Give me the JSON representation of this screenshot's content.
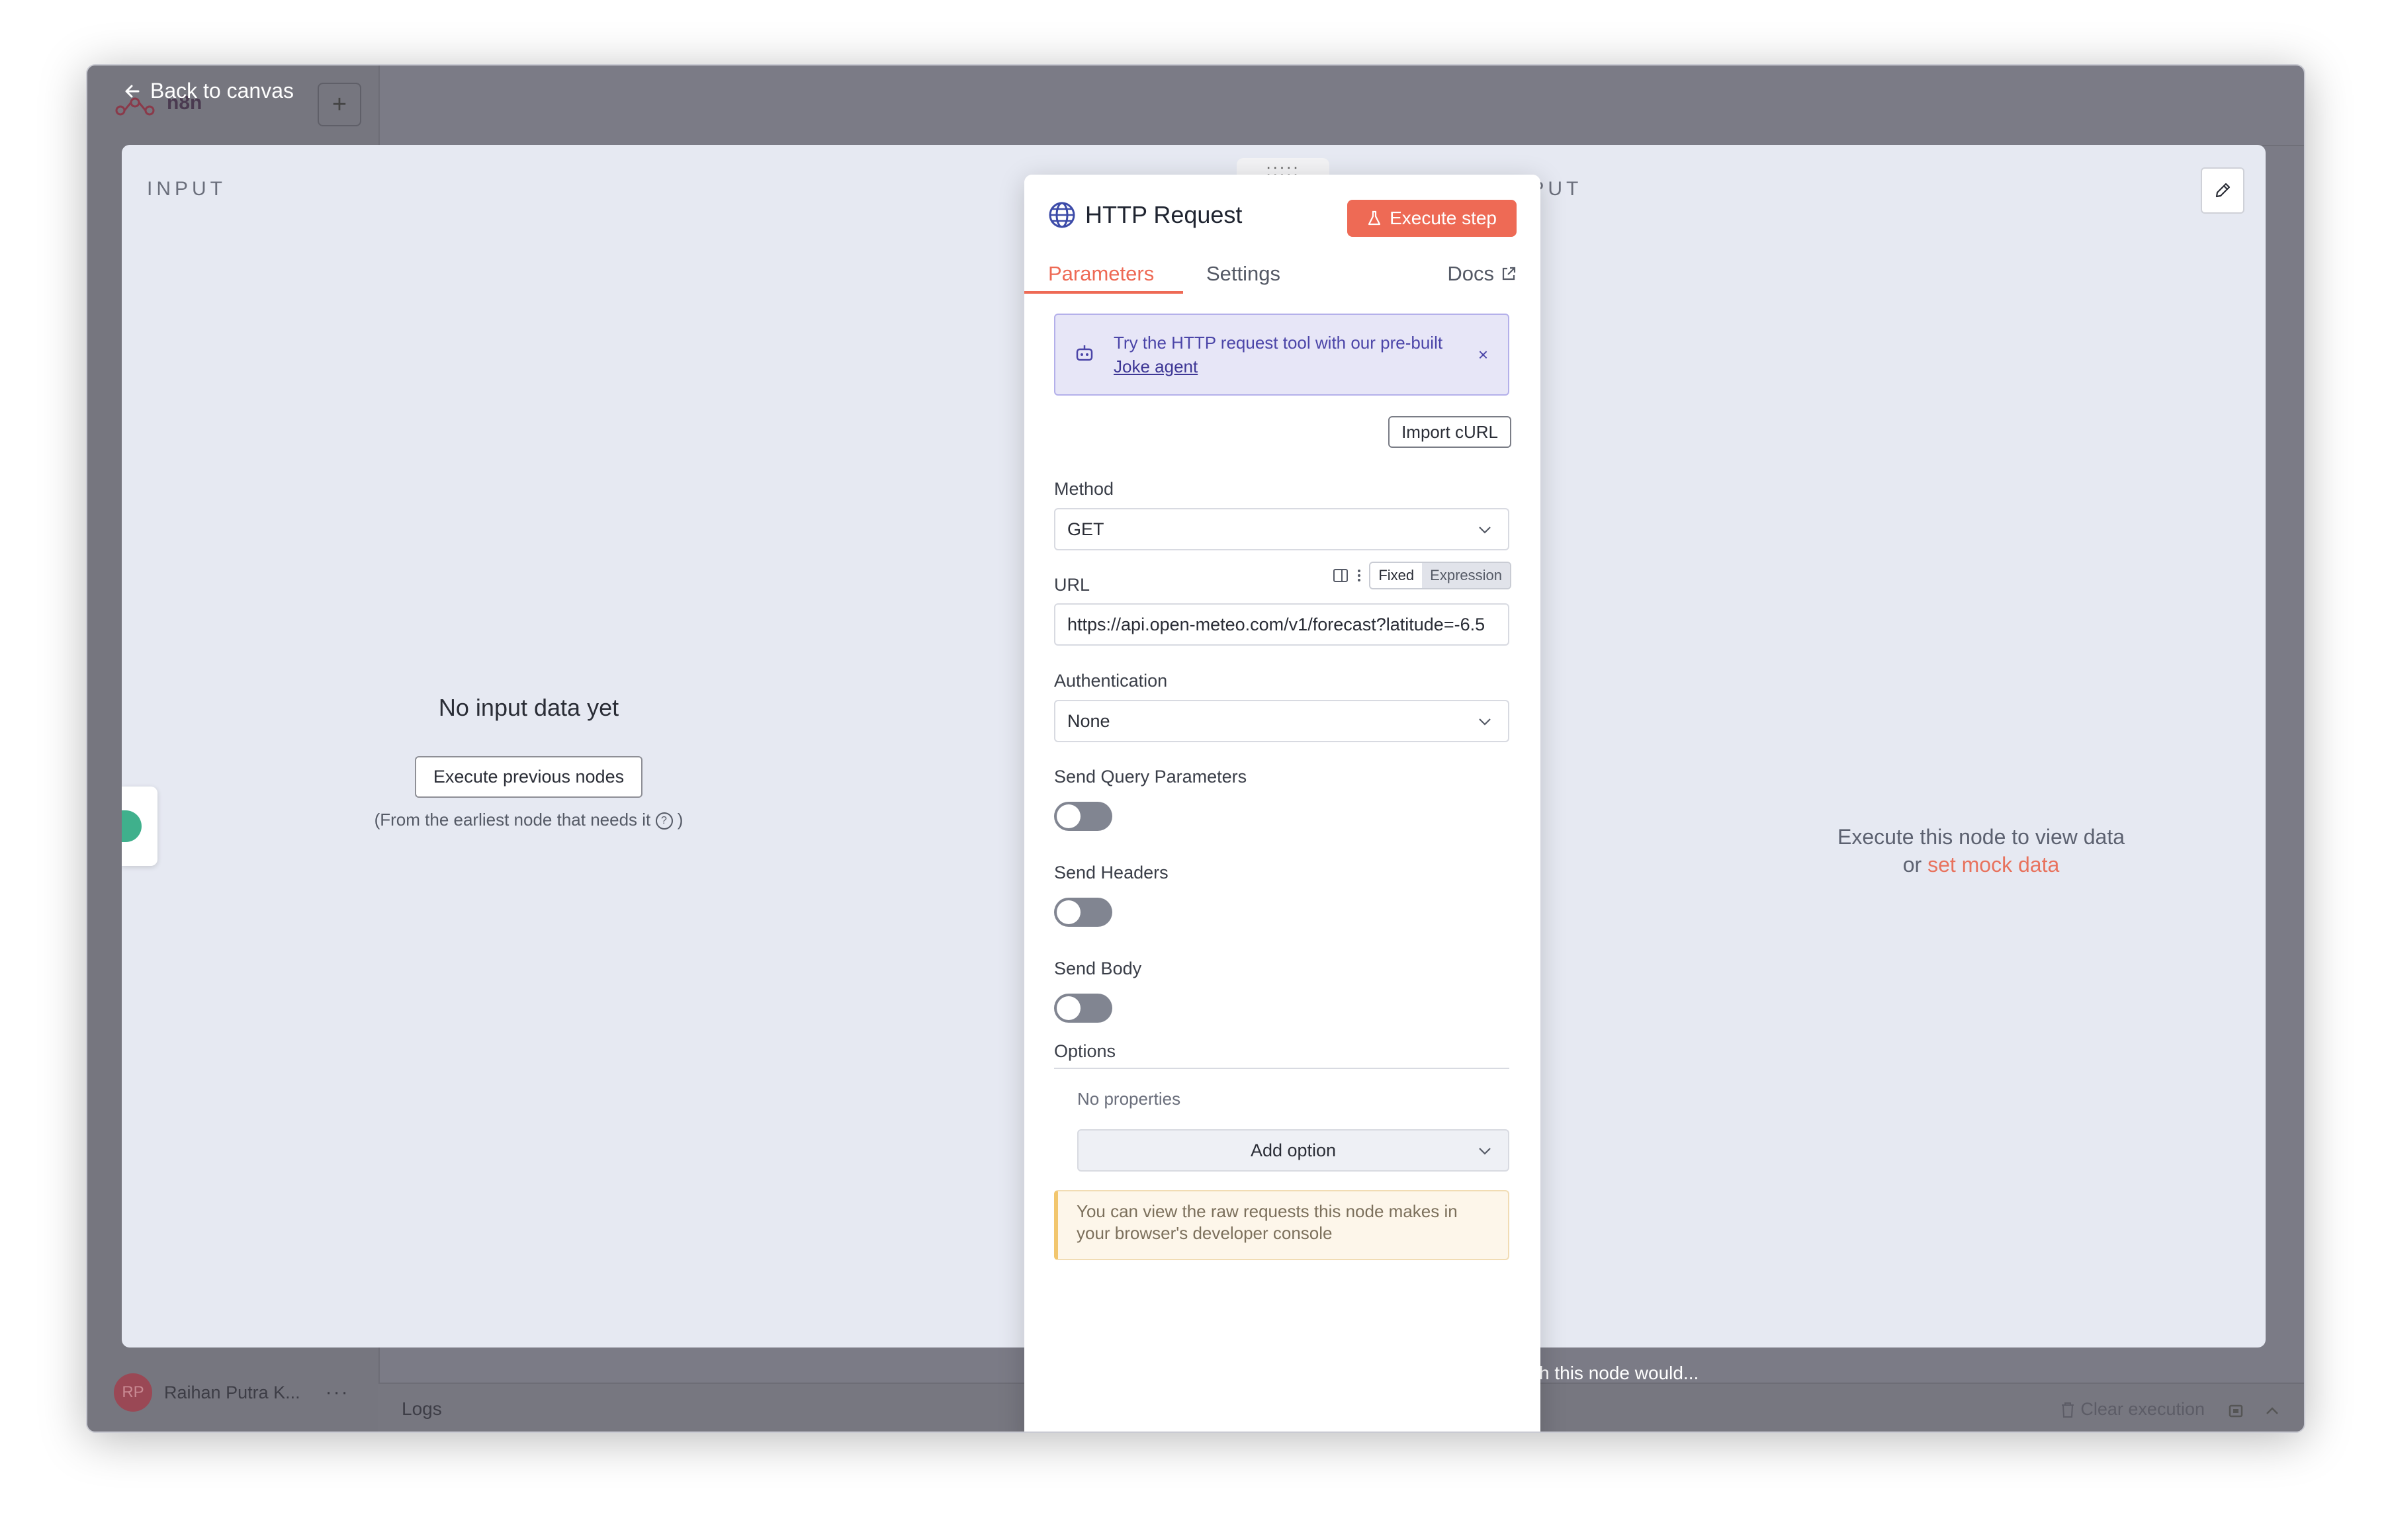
{
  "background": {
    "back_label": "Back to canvas",
    "workspace_name": "n8n",
    "add_label": "+",
    "user": {
      "initials": "RP",
      "name": "Raihan Putra K...",
      "more": "···"
    },
    "logs_label": "Logs",
    "clear_execution": "Clear execution",
    "feedback_prompt": "I wish this node would..."
  },
  "input_panel": {
    "heading": "INPUT",
    "empty_title": "No input data yet",
    "execute_previous_label": "Execute previous nodes",
    "hint_text": "(From the earliest node that needs it",
    "hint_close": ")"
  },
  "output_panel": {
    "heading": "OUTPUT",
    "empty_line1": "Execute this node to view data",
    "empty_line2_prefix": "or",
    "mock_link": "set mock data"
  },
  "node": {
    "drag_handle": ":::::",
    "title": "HTTP Request",
    "execute_label": "Execute step",
    "tabs": [
      {
        "label": "Parameters",
        "active": true
      },
      {
        "label": "Settings",
        "active": false
      }
    ],
    "docs_label": "Docs",
    "banner": {
      "text": "Try the HTTP request tool with our pre-built",
      "link": "Joke agent",
      "close": "×"
    },
    "import_curl_label": "Import cURL",
    "method": {
      "label": "Method",
      "value": "GET"
    },
    "url": {
      "label": "URL",
      "value": "https://api.open-meteo.com/v1/forecast?latitude=-6.5",
      "mode_fixed": "Fixed",
      "mode_expression": "Expression",
      "selected_mode": "Fixed"
    },
    "authentication": {
      "label": "Authentication",
      "value": "None"
    },
    "toggles": [
      {
        "label": "Send Query Parameters",
        "on": false
      },
      {
        "label": "Send Headers",
        "on": false
      },
      {
        "label": "Send Body",
        "on": false
      }
    ],
    "options": {
      "label": "Options",
      "no_properties": "No properties",
      "add_option_label": "Add option"
    },
    "notice": "You can view the raw requests this node makes in your browser's developer console"
  },
  "colors": {
    "accent": "#ee6a55",
    "banner_text": "#4b45a8",
    "notice_border": "#f2c66d",
    "toggle_off": "#818591"
  }
}
